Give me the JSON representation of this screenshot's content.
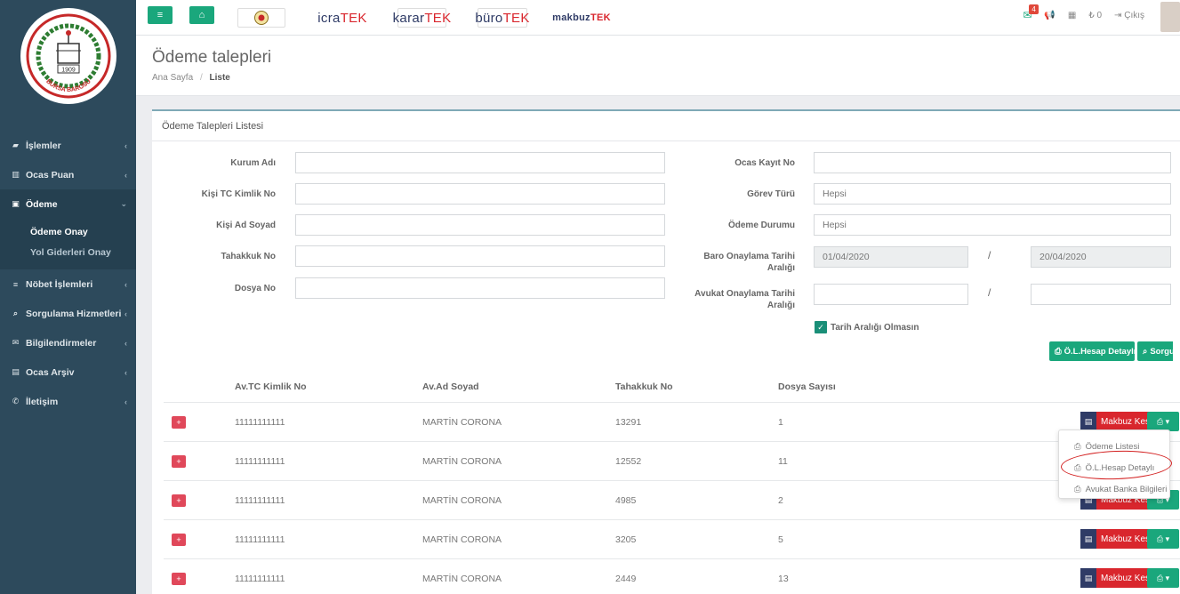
{
  "sidebar": {
    "logo": {
      "year": "1909",
      "name": "BURSA BAROSU"
    },
    "items": [
      {
        "label": "İşlemler",
        "icon": "folder-icon"
      },
      {
        "label": "Ocas Puan",
        "icon": "bar-chart-icon"
      },
      {
        "label": "Ödeme",
        "icon": "money-icon"
      },
      {
        "label": "Nöbet İşlemleri",
        "icon": "list-icon"
      },
      {
        "label": "Sorgulama Hizmetleri",
        "icon": "search-icon"
      },
      {
        "label": "Bilgilendirmeler",
        "icon": "envelope-icon"
      },
      {
        "label": "Ocas Arşiv",
        "icon": "archive-icon"
      },
      {
        "label": "İletişim",
        "icon": "phone-icon"
      }
    ],
    "submenu": [
      {
        "label": "Ödeme Onay"
      },
      {
        "label": "Yol Giderleri Onay"
      }
    ]
  },
  "topbar": {
    "brands": [
      {
        "a": "icra",
        "b": "TEK"
      },
      {
        "a": "karar",
        "b": "TEK"
      },
      {
        "a": "büro",
        "b": "TEK"
      },
      {
        "a": "makbuz",
        "b": "TEK"
      }
    ],
    "mail_count": "4",
    "balance": "0",
    "logout": "Çıkış"
  },
  "page": {
    "title": "Ödeme talepleri",
    "breadcrumb_home": "Ana Sayfa",
    "breadcrumb_sep": "/",
    "breadcrumb_current": "Liste"
  },
  "panel": {
    "title": "Ödeme Talepleri Listesi"
  },
  "form": {
    "kurum_adi": "Kurum Adı",
    "kisi_tc": "Kişi TC Kimlik No",
    "kisi_ad": "Kişi Ad Soyad",
    "tahakkuk": "Tahakkuk No",
    "dosya": "Dosya No",
    "ocas_kayit": "Ocas Kayıt No",
    "gorev_turu": "Görev Türü",
    "gorev_turu_value": "Hepsi",
    "odeme_durumu": "Ödeme Durumu",
    "odeme_durumu_value": "Hepsi",
    "baro_tarih_1": "Baro Onaylama Tarihi",
    "baro_tarih_2": "Aralığı",
    "baro_start": "01/04/2020",
    "baro_end": "20/04/2020",
    "avukat_tarih_1": "Avukat Onaylama Tarihi",
    "avukat_tarih_2": "Aralığı",
    "slash": "/",
    "checkbox_label": "Tarih Aralığı Olmasın",
    "btn_hesap": "Ö.L.Hesap Detaylı",
    "btn_sorgula": "Sorgu"
  },
  "table": {
    "headers": [
      "Av.TC Kimlik No",
      "Av.Ad Soyad",
      "Tahakkuk No",
      "Dosya Sayısı"
    ],
    "rows": [
      {
        "tc": "11111111111",
        "name": "MARTİN CORONA",
        "tahakkuk": "13291",
        "dosya": "1"
      },
      {
        "tc": "11111111111",
        "name": "MARTİN CORONA",
        "tahakkuk": "12552",
        "dosya": "11"
      },
      {
        "tc": "11111111111",
        "name": "MARTİN CORONA",
        "tahakkuk": "4985",
        "dosya": "2"
      },
      {
        "tc": "11111111111",
        "name": "MARTİN CORONA",
        "tahakkuk": "3205",
        "dosya": "5"
      },
      {
        "tc": "11111111111",
        "name": "MARTİN CORONA",
        "tahakkuk": "2449",
        "dosya": "13"
      }
    ],
    "makbuz_label": "Makbuz Kes"
  },
  "dropdown": {
    "items": [
      "Ödeme Listesi",
      "Ö.L.Hesap Detaylı",
      "Avukat Banka Bilgileri"
    ]
  }
}
